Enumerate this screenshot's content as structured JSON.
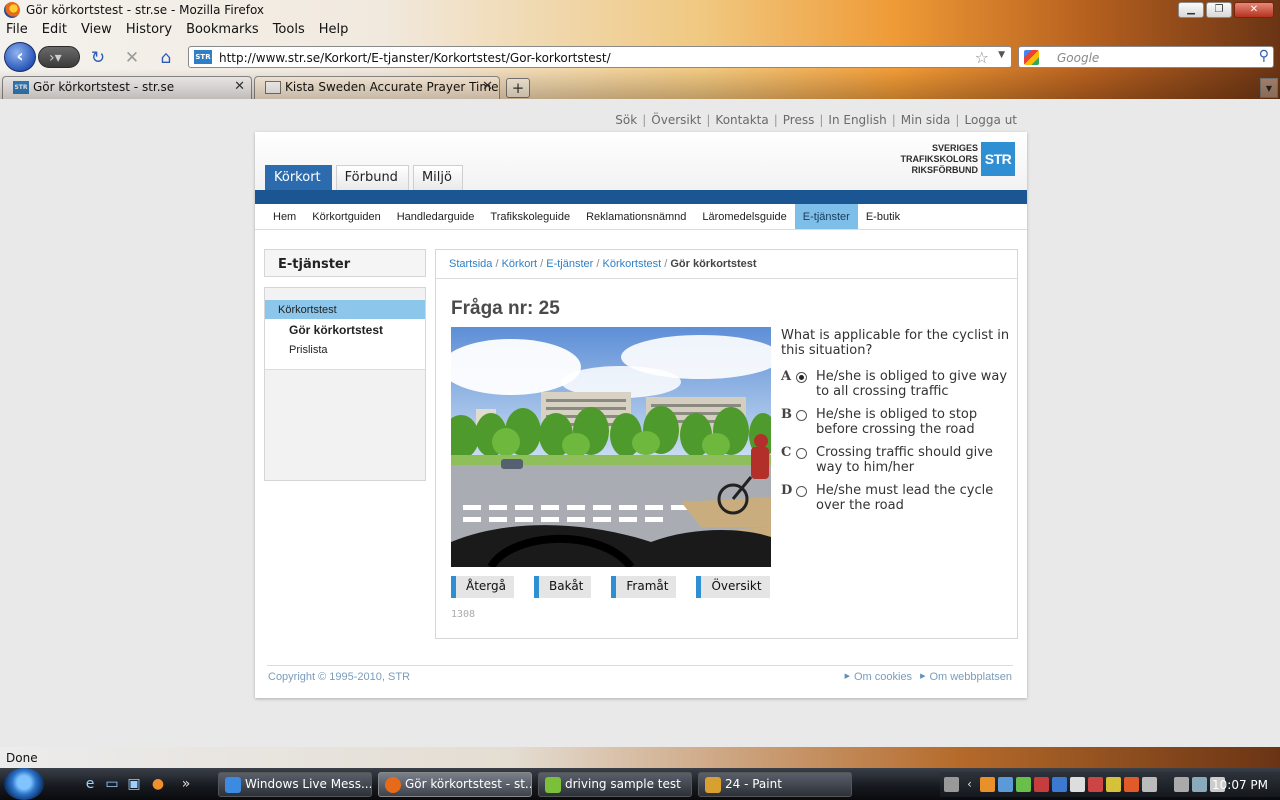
{
  "window": {
    "title": "Gör körkortstest - str.se - Mozilla Firefox",
    "controls": [
      "▁",
      "❐",
      "✕"
    ]
  },
  "menu": [
    "File",
    "Edit",
    "View",
    "History",
    "Bookmarks",
    "Tools",
    "Help"
  ],
  "nav": {
    "url": "http://www.str.se/Korkort/E-tjanster/Korkortstest/Gor-korkortstest/",
    "search_placeholder": "Google",
    "site_badge": "STR"
  },
  "tabs": [
    {
      "label": "Gör körkortstest - str.se",
      "active": true
    },
    {
      "label": "Kista Sweden Accurate Prayer Time...",
      "active": false
    }
  ],
  "toplinks": [
    "Sök",
    "Översikt",
    "Kontakta",
    "Press",
    "In English",
    "Min sida",
    "Logga ut"
  ],
  "logo": {
    "line1": "SVERIGES",
    "line2": "TRAFIKSKOLORS",
    "line3": "RIKSFÖRBUND",
    "box": "STR"
  },
  "main_tabs": [
    "Körkort",
    "Förbund",
    "Miljö"
  ],
  "subnav": [
    "Hem",
    "Körkortguiden",
    "Handledarguide",
    "Trafikskoleguide",
    "Reklamationsnämnd",
    "Läromedelsguide",
    "E-tjänster",
    "E-butik"
  ],
  "subnav_active": "E-tjänster",
  "left": {
    "heading": "E-tjänster",
    "items": [
      {
        "label": "Körkortstest"
      },
      {
        "label": "Gör körkortstest"
      },
      {
        "label": "Prislista"
      }
    ]
  },
  "breadcrumb": {
    "links": [
      "Startsida",
      "Körkort",
      "E-tjänster",
      "Körkortstest"
    ],
    "current": "Gör körkortstest",
    "sep": " / "
  },
  "question": {
    "heading": "Fråga nr: 25",
    "text": "What is applicable for the cyclist in this situation?",
    "answers": [
      {
        "letter": "A",
        "text": "He/she is obliged to give way to all crossing traffic",
        "selected": true
      },
      {
        "letter": "B",
        "text": "He/she is obliged to stop before crossing the road",
        "selected": false
      },
      {
        "letter": "C",
        "text": "Crossing traffic should give way to him/her",
        "selected": false
      },
      {
        "letter": "D",
        "text": "He/she must lead the cycle over the road",
        "selected": false
      }
    ],
    "buttons": [
      "Återgå",
      "Bakåt",
      "Framåt",
      "Översikt"
    ],
    "counter": "1308"
  },
  "footer": {
    "copyright": "Copyright © 1995-2010, STR",
    "links": [
      "Om cookies",
      "Om webbplatsen"
    ]
  },
  "status": "Done",
  "taskbar": {
    "items": [
      {
        "label": "Windows Live Mess...",
        "color": "#3d8be0"
      },
      {
        "label": "Gör körkortstest - st...",
        "color": "#e66a1a"
      },
      {
        "label": "driving sample test",
        "color": "#7cbf3a"
      },
      {
        "label": "24 - Paint",
        "color": "#d8a030"
      }
    ],
    "clock": "10:07 PM"
  },
  "colors": {
    "accent_blue": "#2c6cae",
    "band_blue": "#1b5592",
    "active_sub": "#7ebfe9",
    "link_blue": "#2f7fc6"
  }
}
